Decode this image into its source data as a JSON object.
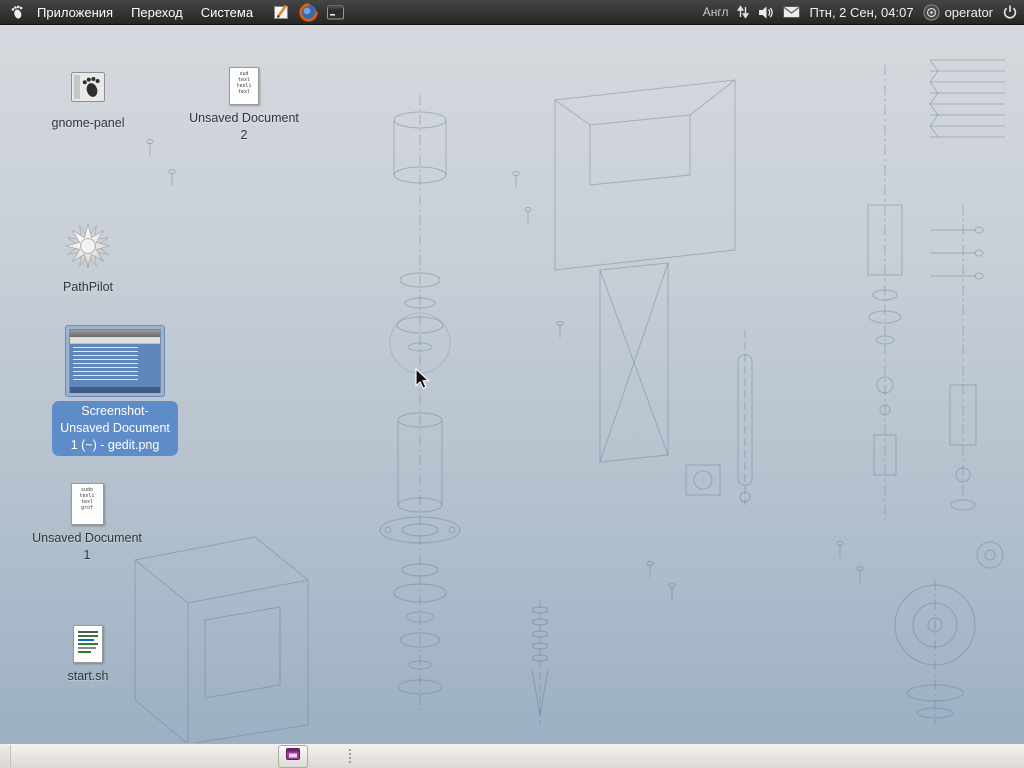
{
  "colors": {
    "selection_blue": "#5e8cc9",
    "panel_top": "#2e2e2e",
    "panel_bottom": "#e6e3de",
    "desktop_gradient_top": "#d5d9de",
    "desktop_gradient_bottom": "#9cb0c4"
  },
  "top_panel": {
    "menus": [
      {
        "label": "Приложения"
      },
      {
        "label": "Переход"
      },
      {
        "label": "Система"
      }
    ],
    "launchers": [
      {
        "name": "gedit"
      },
      {
        "name": "firefox"
      },
      {
        "name": "terminal"
      }
    ],
    "indicators": {
      "keyboard_layout": "Англ",
      "clock": "Птн, 2 Сен, 04:07",
      "user": "operator"
    }
  },
  "desktop": {
    "icons": [
      {
        "id": "gnome-panel",
        "lines": [
          "gnome-panel"
        ]
      },
      {
        "id": "unsaved-document-2",
        "lines": [
          "Unsaved Document",
          "2"
        ],
        "preview": [
          "sud",
          "texl",
          "texli",
          "texl"
        ]
      },
      {
        "id": "pathpilot",
        "lines": [
          "PathPilot"
        ]
      },
      {
        "id": "screenshot-gedit-png",
        "selected": true,
        "lines": [
          "Screenshot-",
          "Unsaved Document",
          "1 (~) - gedit.png"
        ]
      },
      {
        "id": "unsaved-document-1",
        "lines": [
          "Unsaved Document",
          "1"
        ],
        "preview": [
          "sudo",
          "texli",
          "texl",
          "grof"
        ]
      },
      {
        "id": "start-sh",
        "lines": [
          "start.sh"
        ]
      }
    ]
  },
  "bottom_panel": {
    "window_buttons": [
      {
        "name": "screenshot-window"
      }
    ]
  }
}
